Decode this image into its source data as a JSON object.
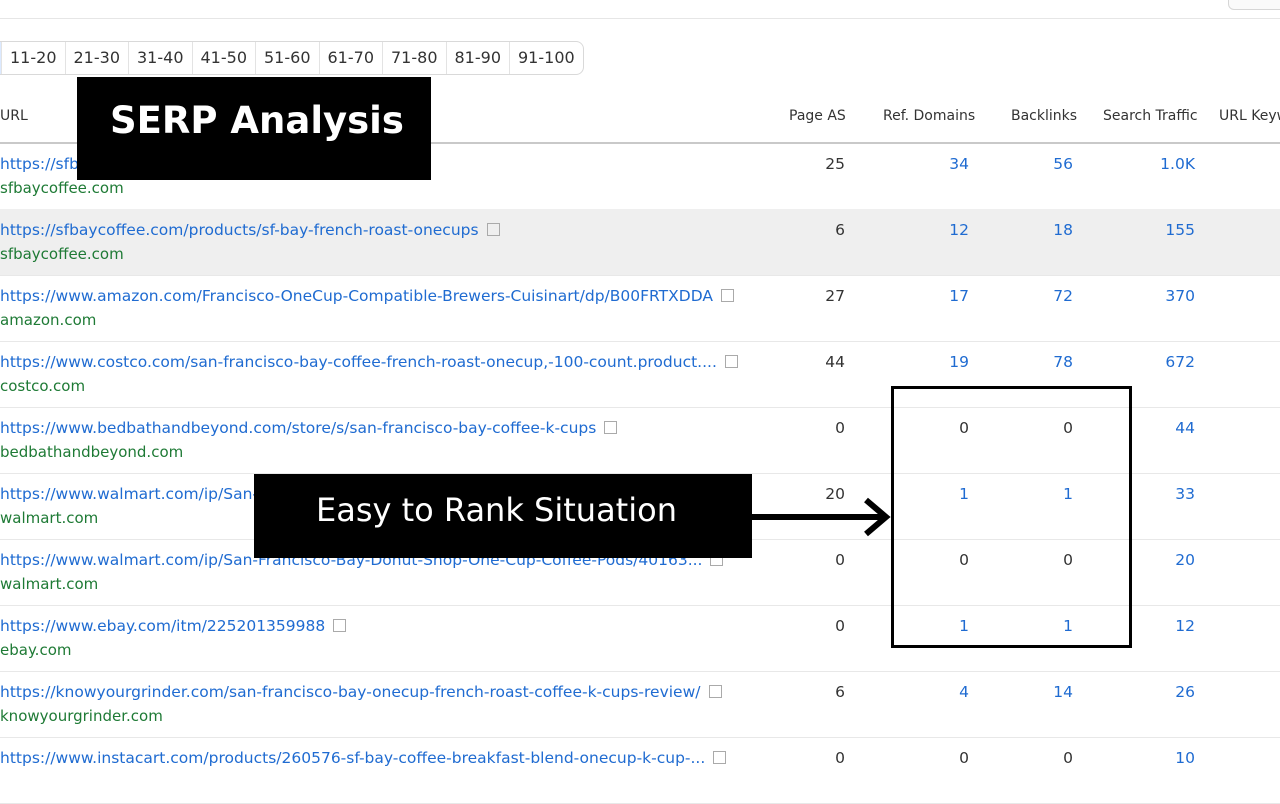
{
  "pagination": [
    "11-20",
    "21-30",
    "31-40",
    "41-50",
    "51-60",
    "61-70",
    "71-80",
    "81-90",
    "91-100"
  ],
  "columns": {
    "url": "URL",
    "page_as": "Page AS",
    "ref_domains": "Ref. Domains",
    "backlinks": "Backlinks",
    "search_traffic": "Search Traffic",
    "url_keywords": "URL Keyw"
  },
  "rows": [
    {
      "url": "https://sfb",
      "domain": "sfbaycoffee.com",
      "page_as": "25",
      "ref_domains": "34",
      "backlinks": "56",
      "traffic": "1.0K"
    },
    {
      "url": "https://sfbaycoffee.com/products/sf-bay-french-roast-onecups",
      "domain": "sfbaycoffee.com",
      "page_as": "6",
      "ref_domains": "12",
      "backlinks": "18",
      "traffic": "155"
    },
    {
      "url": "https://www.amazon.com/Francisco-OneCup-Compatible-Brewers-Cuisinart/dp/B00FRTXDDA",
      "domain": "amazon.com",
      "page_as": "27",
      "ref_domains": "17",
      "backlinks": "72",
      "traffic": "370"
    },
    {
      "url": "https://www.costco.com/san-francisco-bay-coffee-french-roast-onecup,-100-count.product....",
      "domain": "costco.com",
      "page_as": "44",
      "ref_domains": "19",
      "backlinks": "78",
      "traffic": "672"
    },
    {
      "url": "https://www.bedbathandbeyond.com/store/s/san-francisco-bay-coffee-k-cups",
      "domain": "bedbathandbeyond.com",
      "page_as": "0",
      "ref_domains": "0",
      "backlinks": "0",
      "traffic": "44"
    },
    {
      "url": "https://www.walmart.com/ip/San-",
      "domain": "walmart.com",
      "page_as": "20",
      "ref_domains": "1",
      "backlinks": "1",
      "traffic": "33"
    },
    {
      "url": "https://www.walmart.com/ip/San-Francisco-Bay-Donut-Shop-One-Cup-Coffee-Pods/40163...",
      "domain": "walmart.com",
      "page_as": "0",
      "ref_domains": "0",
      "backlinks": "0",
      "traffic": "20"
    },
    {
      "url": "https://www.ebay.com/itm/225201359988",
      "domain": "ebay.com",
      "page_as": "0",
      "ref_domains": "1",
      "backlinks": "1",
      "traffic": "12"
    },
    {
      "url": "https://knowyourgrinder.com/san-francisco-bay-onecup-french-roast-coffee-k-cups-review/",
      "domain": "knowyourgrinder.com",
      "page_as": "6",
      "ref_domains": "4",
      "backlinks": "14",
      "traffic": "26"
    },
    {
      "url": "https://www.instacart.com/products/260576-sf-bay-coffee-breakfast-blend-onecup-k-cup-...",
      "domain": "",
      "page_as": "0",
      "ref_domains": "0",
      "backlinks": "0",
      "traffic": "10"
    }
  ],
  "overlays": {
    "serp_label": "SERP Analysis",
    "easy_label": "Easy to Rank Situation"
  },
  "colors": {
    "link": "#1f6bd1",
    "domain": "#1e7a35",
    "overlay_bg": "#000000"
  }
}
